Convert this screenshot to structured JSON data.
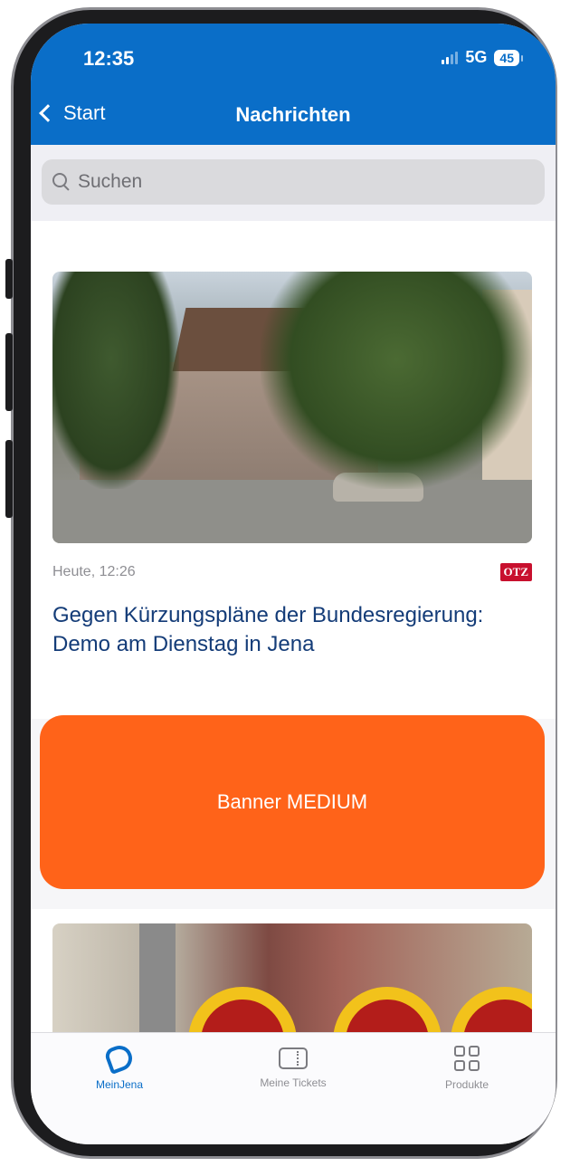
{
  "status_bar": {
    "time": "12:35",
    "network": "5G",
    "battery": "45"
  },
  "nav": {
    "back_label": "Start",
    "title": "Nachrichten"
  },
  "search": {
    "placeholder": "Suchen"
  },
  "feed": {
    "articles": [
      {
        "date": "Heute, 12:26",
        "source": "OTZ",
        "headline": "Gegen Kürzungspläne der Bundesregierung: Demo am Dienstag in Jena"
      }
    ],
    "banner_label": "Banner MEDIUM"
  },
  "tabbar": {
    "items": [
      {
        "label": "MeinJena",
        "icon": "meinjena-logo-icon",
        "active": true
      },
      {
        "label": "Meine Tickets",
        "icon": "ticket-icon",
        "active": false
      },
      {
        "label": "Produkte",
        "icon": "grid-icon",
        "active": false
      }
    ]
  },
  "colors": {
    "brand_blue": "#0a6ec8",
    "banner_orange": "#ff6319",
    "headline_blue": "#143c78",
    "otz_red": "#c8102e"
  }
}
